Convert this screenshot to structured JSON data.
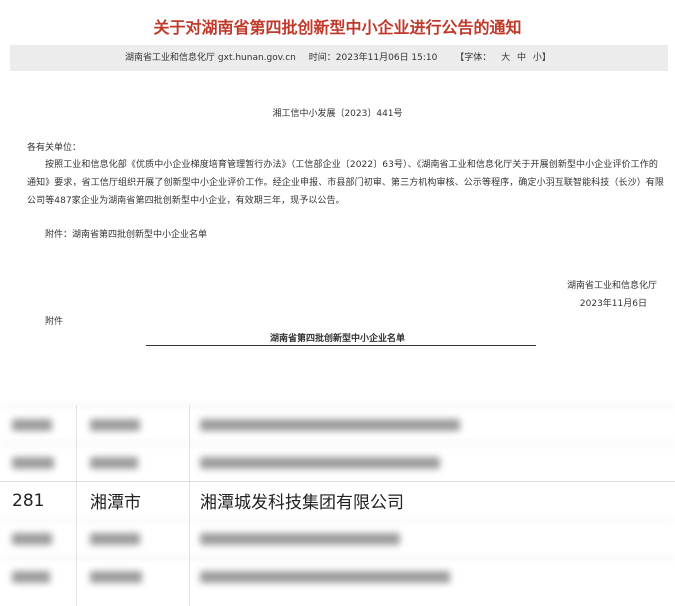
{
  "header": {
    "title": "关于对湖南省第四批创新型中小企业进行公告的通知",
    "source": "湖南省工业和信息化厅 gxt.hunan.gov.cn",
    "time": "时间：2023年11月06日 15:10",
    "font_label": "【字体：",
    "font_large": "大",
    "font_medium": "中",
    "font_small": "小】"
  },
  "doc": {
    "number": "湘工信中小发展〔2023〕441号",
    "salutation": "各有关单位：",
    "body": "按照工业和信息化部《优质中小企业梯度培育管理暂行办法》（工信部企业〔2022〕63号）、《湖南省工业和信息化厅关于开展创新型中小企业评价工作的通知》要求，省工信厅组织开展了创新型中小企业评价工作。经企业申报、市县部门初审、第三方机构审核、公示等程序，确定小羽互联智能科技（长沙）有限公司等487家企业为湖南省第四批创新型中小企业，有效期三年，现予以公告。",
    "attachment_line": "附件：湖南省第四批创新型中小企业名单",
    "signer_org": "湖南省工业和信息化厅",
    "signer_date": "2023年11月6日",
    "attachment_label": "附件",
    "list_title": "湖南省第四批创新型中小企业名单"
  },
  "table": {
    "visible_row": {
      "index": "281",
      "city": "湘潭市",
      "company": "湘潭城发科技集团有限公司"
    }
  }
}
